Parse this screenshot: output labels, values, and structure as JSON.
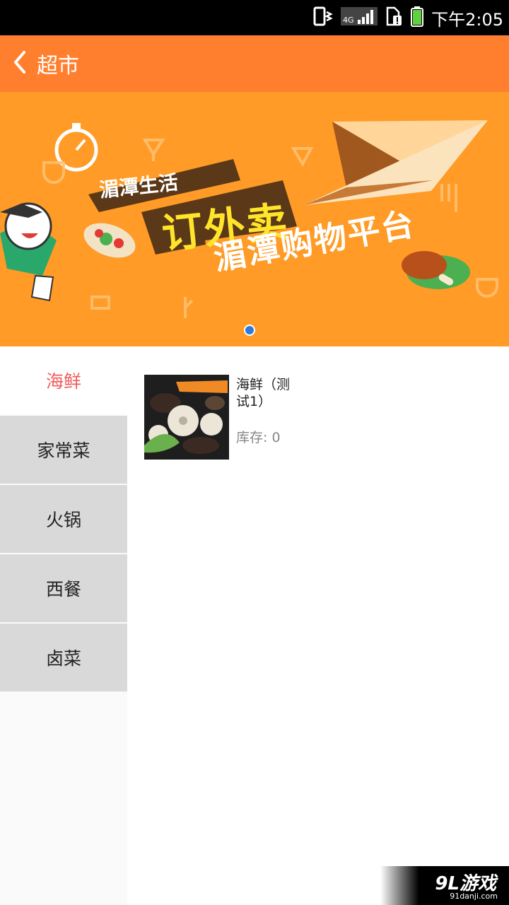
{
  "status_bar": {
    "network": "4G",
    "time": "下午2:05",
    "icons": [
      "vibrate-icon",
      "signal-4g-icon",
      "sim-alert-icon",
      "battery-icon"
    ]
  },
  "app_bar": {
    "title": "超市",
    "back_icon": "chevron-left-icon"
  },
  "banner": {
    "line1": "湄潭生活",
    "line2": "订外卖",
    "line3": "湄潭购物平台",
    "pager": {
      "count": 1,
      "active": 0
    },
    "colors": {
      "background": "#ff9b26",
      "highlight": "#ffe42a"
    }
  },
  "categories": [
    {
      "label": "海鲜",
      "active": true
    },
    {
      "label": "家常菜",
      "active": false
    },
    {
      "label": "火锅",
      "active": false
    },
    {
      "label": "西餐",
      "active": false
    },
    {
      "label": "卤菜",
      "active": false
    }
  ],
  "products": [
    {
      "name": "海鲜（测试1）",
      "stock": "库存: 0"
    }
  ],
  "watermark": {
    "main": "9L游戏",
    "sub": "91danji.com"
  },
  "colors": {
    "accent": "#ff7f2f",
    "active_category": "#f25c5c",
    "inactive_category_bg": "#d9d9d9"
  }
}
